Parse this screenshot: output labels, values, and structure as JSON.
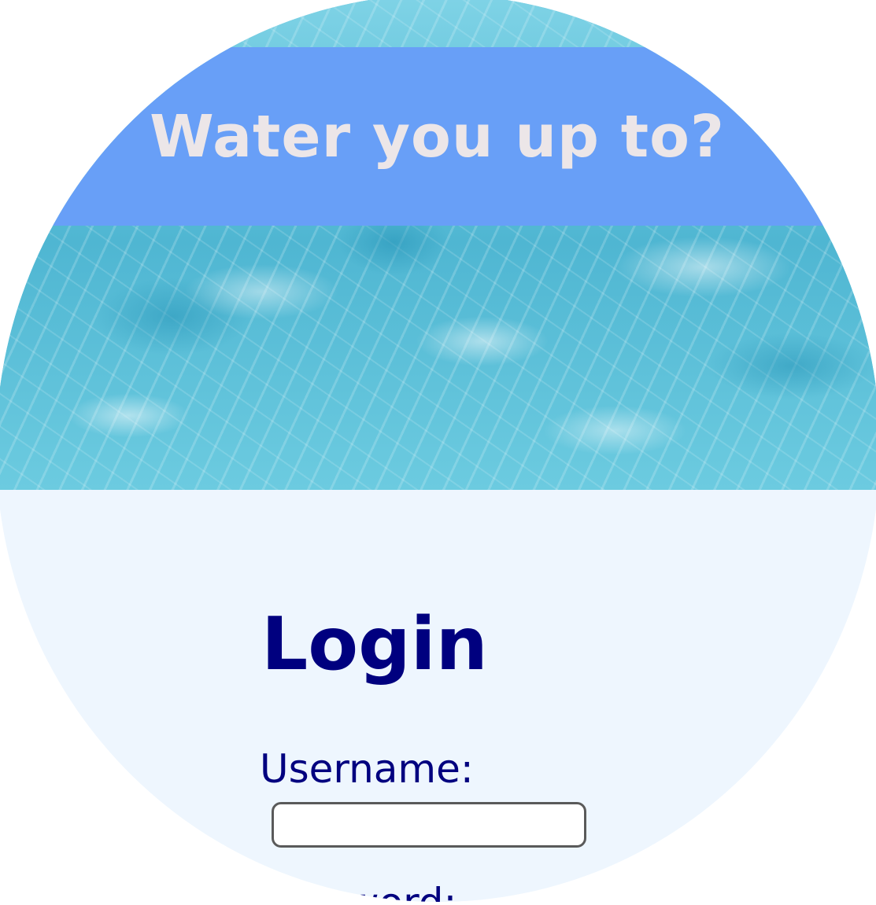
{
  "header": {
    "title": "Water you up to?"
  },
  "login": {
    "heading": "Login",
    "username_label": "Username:",
    "username_value": "",
    "password_label": "Password:"
  },
  "colors": {
    "banner": "#689ff7",
    "banner_text": "#ece6e8",
    "heading_text": "#00007f",
    "form_background": "#eef6fe"
  }
}
